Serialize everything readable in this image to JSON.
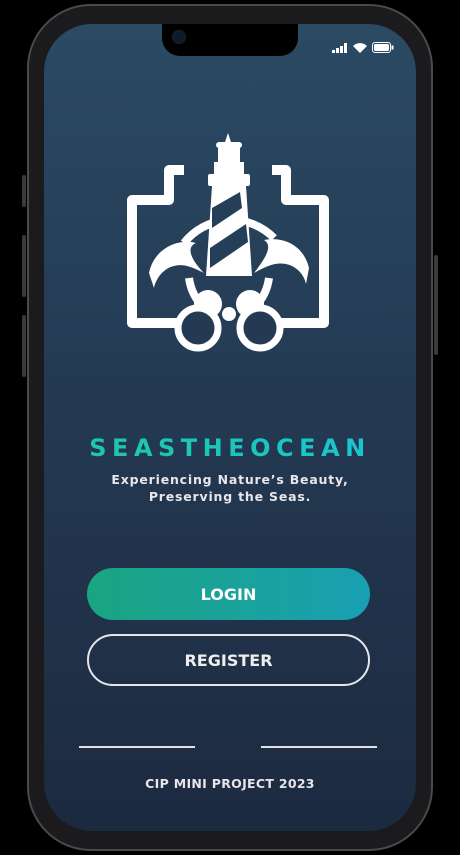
{
  "app": {
    "brand": "SEASTHEOCEAN",
    "tagline_line1": "Experiencing Nature’s Beauty,",
    "tagline_line2": "Preserving the Seas.",
    "footer": "CIP MINI PROJECT 2023"
  },
  "actions": {
    "login_label": "LOGIN",
    "register_label": "REGISTER"
  },
  "icons": {
    "logo": "lighthouse-dolphins-binoculars-logo",
    "status": [
      "signal-icon",
      "wifi-icon",
      "battery-icon"
    ]
  },
  "colors": {
    "brand_accent": "#1fd0c4",
    "login_start": "#1aa581",
    "login_end": "#199fb2",
    "background": "#243a53"
  }
}
